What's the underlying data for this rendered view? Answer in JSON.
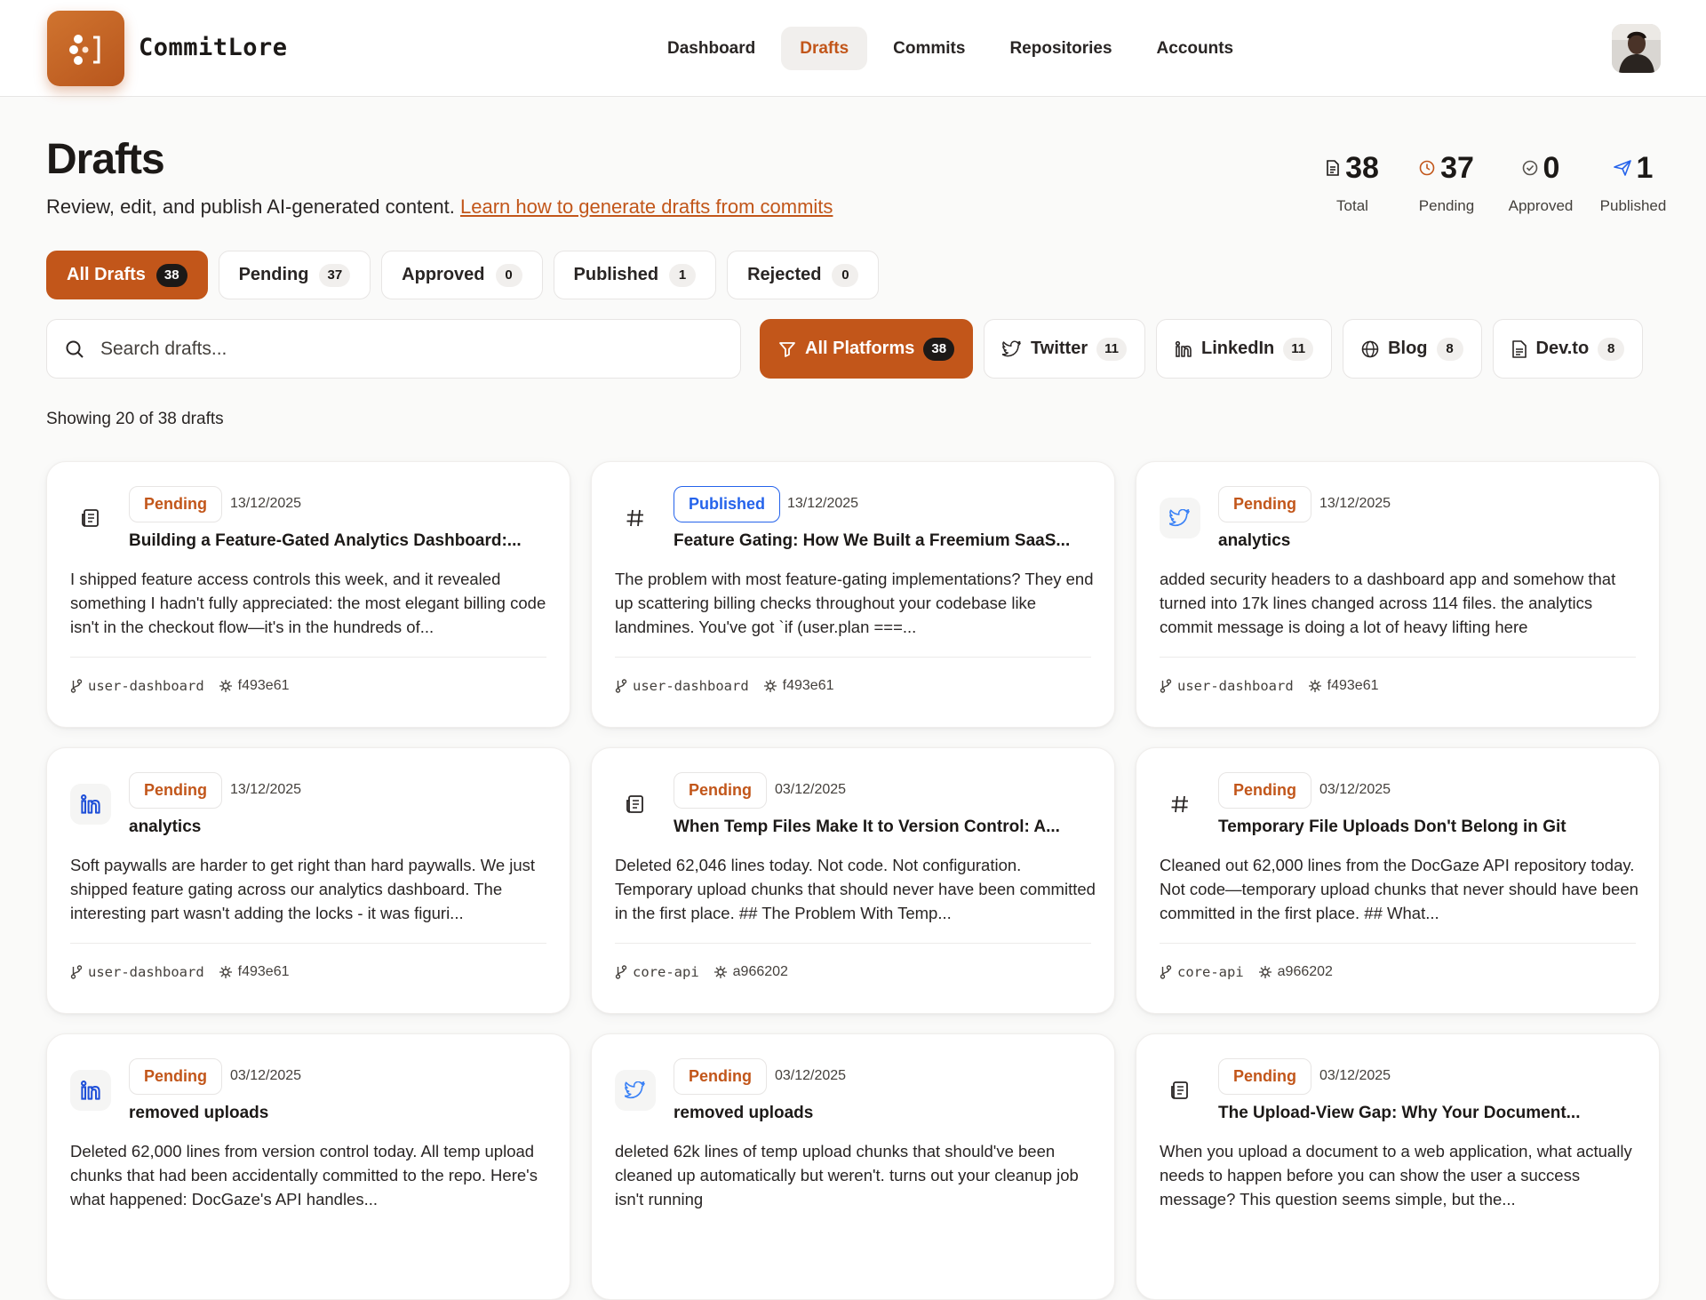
{
  "app": {
    "name": "CommitLore"
  },
  "nav": [
    {
      "label": "Dashboard",
      "active": false
    },
    {
      "label": "Drafts",
      "active": true
    },
    {
      "label": "Commits",
      "active": false
    },
    {
      "label": "Repositories",
      "active": false
    },
    {
      "label": "Accounts",
      "active": false
    }
  ],
  "header": {
    "title": "Drafts",
    "subtitle": "Review, edit, and publish AI-generated content.",
    "link": "Learn how to generate drafts from commits"
  },
  "stats": [
    {
      "value": "38",
      "label": "Total",
      "icon": "document-icon"
    },
    {
      "value": "37",
      "label": "Pending",
      "icon": "clock-icon"
    },
    {
      "value": "0",
      "label": "Approved",
      "icon": "check-circle-icon"
    },
    {
      "value": "1",
      "label": "Published",
      "icon": "send-icon"
    }
  ],
  "status_tabs": [
    {
      "label": "All Drafts",
      "count": "38",
      "active": true
    },
    {
      "label": "Pending",
      "count": "37",
      "active": false
    },
    {
      "label": "Approved",
      "count": "0",
      "active": false
    },
    {
      "label": "Published",
      "count": "1",
      "active": false
    },
    {
      "label": "Rejected",
      "count": "0",
      "active": false
    }
  ],
  "search": {
    "placeholder": "Search drafts..."
  },
  "platforms": [
    {
      "label": "All Platforms",
      "count": "38",
      "icon": "filter-icon",
      "active": true
    },
    {
      "label": "Twitter",
      "count": "11",
      "icon": "twitter-icon",
      "active": false
    },
    {
      "label": "LinkedIn",
      "count": "11",
      "icon": "linkedin-icon",
      "active": false
    },
    {
      "label": "Blog",
      "count": "8",
      "icon": "globe-icon",
      "active": false
    },
    {
      "label": "Dev.to",
      "count": "8",
      "icon": "document-icon",
      "active": false
    }
  ],
  "showing": "Showing 20 of 38 drafts",
  "colors": {
    "accent": "#c2561a",
    "published": "#2563eb"
  },
  "cards": [
    {
      "platform_icon": "newspaper-icon",
      "status": "Pending",
      "date": "13/12/2025",
      "title": "Building a Feature-Gated Analytics Dashboard:...",
      "body": "I shipped feature access controls this week, and it revealed something I hadn't fully appreciated: the most elegant billing code isn't in the checkout flow—it's in the hundreds of...",
      "repo": "user-dashboard",
      "sha": "f493e61"
    },
    {
      "platform_icon": "hash-icon",
      "status": "Published",
      "date": "13/12/2025",
      "title": "Feature Gating: How We Built a Freemium SaaS...",
      "body": "The problem with most feature-gating implementations? They end up scattering billing checks throughout your codebase like landmines. You've got `if (user.plan ===...",
      "repo": "user-dashboard",
      "sha": "f493e61"
    },
    {
      "platform_icon": "twitter-icon",
      "status": "Pending",
      "date": "13/12/2025",
      "title": "analytics",
      "body": "added security headers to a dashboard app and somehow that turned into 17k lines changed across 114 files. the analytics commit message is doing a lot of heavy lifting here",
      "repo": "user-dashboard",
      "sha": "f493e61"
    },
    {
      "platform_icon": "linkedin-icon",
      "status": "Pending",
      "date": "13/12/2025",
      "title": "analytics",
      "body": "Soft paywalls are harder to get right than hard paywalls. We just shipped feature gating across our analytics dashboard. The interesting part wasn't adding the locks - it was figuri...",
      "repo": "user-dashboard",
      "sha": "f493e61"
    },
    {
      "platform_icon": "newspaper-icon",
      "status": "Pending",
      "date": "03/12/2025",
      "title": "When Temp Files Make It to Version Control: A...",
      "body": "Deleted 62,046 lines today. Not code. Not configuration. Temporary upload chunks that should never have been committed in the first place. ## The Problem With Temp...",
      "repo": "core-api",
      "sha": "a966202"
    },
    {
      "platform_icon": "hash-icon",
      "status": "Pending",
      "date": "03/12/2025",
      "title": "Temporary File Uploads Don't Belong in Git",
      "body": "Cleaned out 62,000 lines from the DocGaze API repository today. Not code—temporary upload chunks that never should have been committed in the first place. ## What...",
      "repo": "core-api",
      "sha": "a966202"
    },
    {
      "platform_icon": "linkedin-icon",
      "status": "Pending",
      "date": "03/12/2025",
      "title": "removed uploads",
      "body": "Deleted 62,000 lines from version control today. All temp upload chunks that had been accidentally committed to the repo. Here's what happened: DocGaze's API handles...",
      "repo": "",
      "sha": ""
    },
    {
      "platform_icon": "twitter-icon",
      "status": "Pending",
      "date": "03/12/2025",
      "title": "removed uploads",
      "body": "deleted 62k lines of temp upload chunks that should've been cleaned up automatically but weren't. turns out your cleanup job isn't running",
      "repo": "",
      "sha": ""
    },
    {
      "platform_icon": "newspaper-icon",
      "status": "Pending",
      "date": "03/12/2025",
      "title": "The Upload-View Gap: Why Your Document...",
      "body": "When you upload a document to a web application, what actually needs to happen before you can show the user a success message? This question seems simple, but the...",
      "repo": "",
      "sha": ""
    }
  ]
}
